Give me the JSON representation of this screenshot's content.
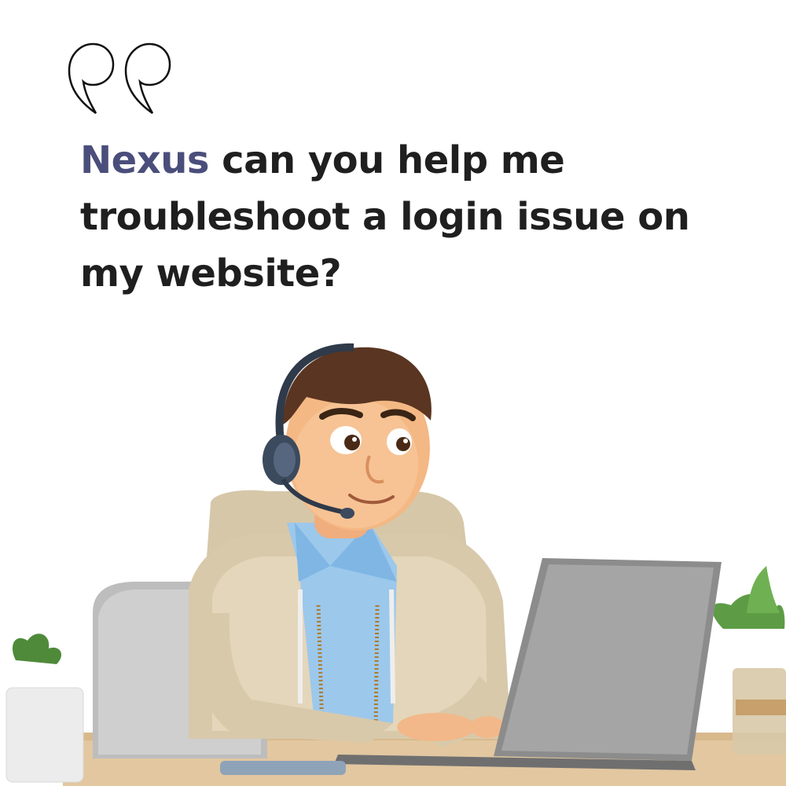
{
  "quote": {
    "brand": "Nexus",
    "message": " can you help me troubleshoot a login issue on my website?"
  },
  "colors": {
    "brand": "#4a4e7a",
    "text": "#1f1f1f",
    "background": "#ffffff"
  },
  "icons": {
    "quote": "quote-open-icon"
  }
}
